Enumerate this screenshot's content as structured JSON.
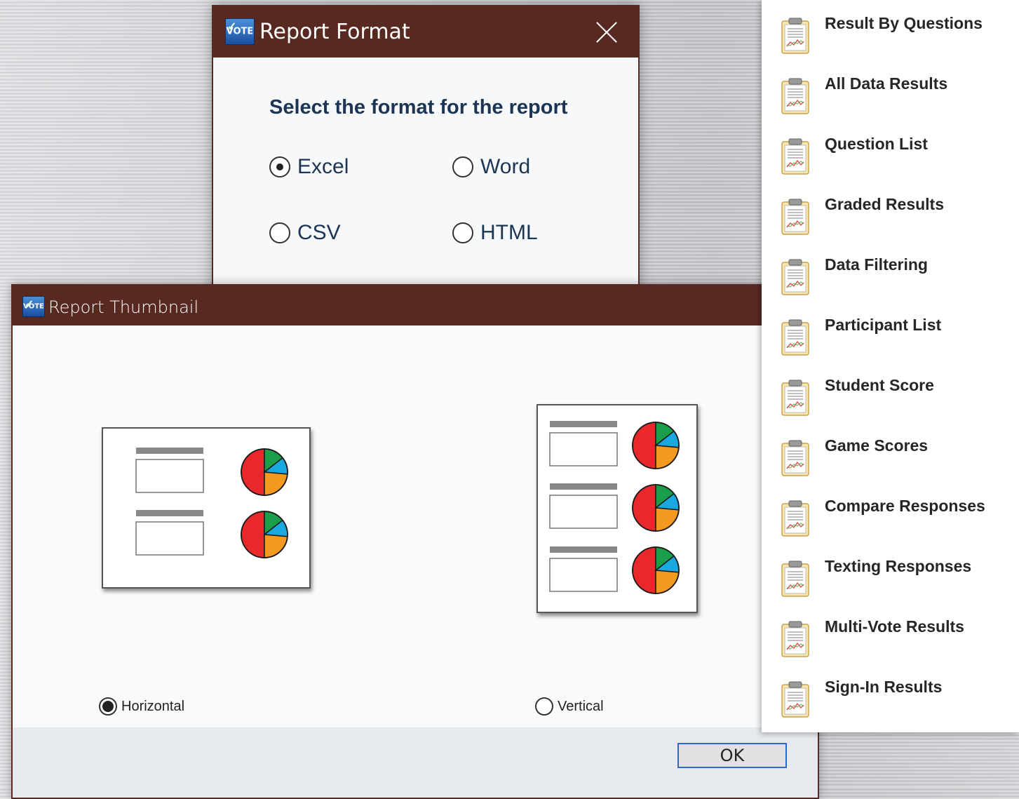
{
  "colors": {
    "titlebar": "#582921",
    "heading": "#1c3553",
    "pie_red": "#e8282a",
    "pie_green": "#1a9e4a",
    "pie_blue": "#19a8e0",
    "pie_orange": "#f39a1f"
  },
  "report_format": {
    "title": "Report Format",
    "icon": "vote-app-icon",
    "icon_text": "VOTE",
    "close_icon": "close-icon",
    "heading": "Select the format for the report",
    "options": [
      {
        "label": "Excel",
        "selected": true
      },
      {
        "label": "Word",
        "selected": false
      },
      {
        "label": "CSV",
        "selected": false
      },
      {
        "label": "HTML",
        "selected": false
      }
    ]
  },
  "report_thumbnail": {
    "title": "Report Thumbnail",
    "icon": "vote-app-icon",
    "icon_text": "VOTE",
    "orientations": [
      {
        "label": "Horizontal",
        "selected": true
      },
      {
        "label": "Vertical",
        "selected": false
      }
    ],
    "ok_label": "OK"
  },
  "report_types": {
    "icon": "clipboard-chart-icon",
    "items": [
      {
        "label": "Result By Questions"
      },
      {
        "label": "All Data Results"
      },
      {
        "label": "Question List"
      },
      {
        "label": "Graded Results"
      },
      {
        "label": "Data Filtering"
      },
      {
        "label": "Participant List"
      },
      {
        "label": "Student Score"
      },
      {
        "label": "Game Scores"
      },
      {
        "label": "Compare Responses"
      },
      {
        "label": "Texting Responses"
      },
      {
        "label": "Multi-Vote Results"
      },
      {
        "label": "Sign-In Results"
      }
    ]
  }
}
